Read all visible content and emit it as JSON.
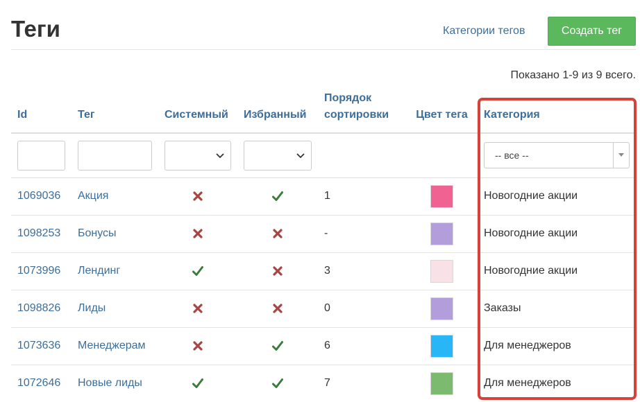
{
  "header": {
    "title": "Теги",
    "categories_link": "Категории тегов",
    "create_button": "Создать тег"
  },
  "summary": "Показано 1-9 из 9 всего.",
  "columns": {
    "id": "Id",
    "tag": "Тег",
    "system": "Системный",
    "favorite": "Избранный",
    "sort_order": "Порядок сортировки",
    "color": "Цвет тега",
    "category": "Категория"
  },
  "filters": {
    "category_selected": "-- все --"
  },
  "rows": [
    {
      "id": "1069036",
      "tag": "Акция",
      "system": false,
      "favorite": true,
      "sort": "1",
      "color": "#f06292",
      "category": "Новогодние акции"
    },
    {
      "id": "1098253",
      "tag": "Бонусы",
      "system": false,
      "favorite": false,
      "sort": "-",
      "color": "#b39ddb",
      "category": "Новогодние акции"
    },
    {
      "id": "1073996",
      "tag": "Лендинг",
      "system": true,
      "favorite": false,
      "sort": "3",
      "color": "#f8e1e7",
      "category": "Новогодние акции"
    },
    {
      "id": "1098826",
      "tag": "Лиды",
      "system": false,
      "favorite": false,
      "sort": "0",
      "color": "#b39ddb",
      "category": "Заказы"
    },
    {
      "id": "1073636",
      "tag": "Менеджерам",
      "system": false,
      "favorite": true,
      "sort": "6",
      "color": "#29b6f6",
      "category": "Для менеджеров"
    },
    {
      "id": "1072646",
      "tag": "Новые лиды",
      "system": true,
      "favorite": true,
      "sort": "7",
      "color": "#7cbb6f",
      "category": "Для менеджеров"
    }
  ],
  "icons": {
    "true_icon": "check-icon",
    "false_icon": "cross-icon",
    "check_color": "#3a7d3a",
    "cross_color": "#a94442"
  },
  "colors": {
    "link": "#3d6d99",
    "create_button_bg": "#5cb85c",
    "highlight": "#d8403a"
  }
}
